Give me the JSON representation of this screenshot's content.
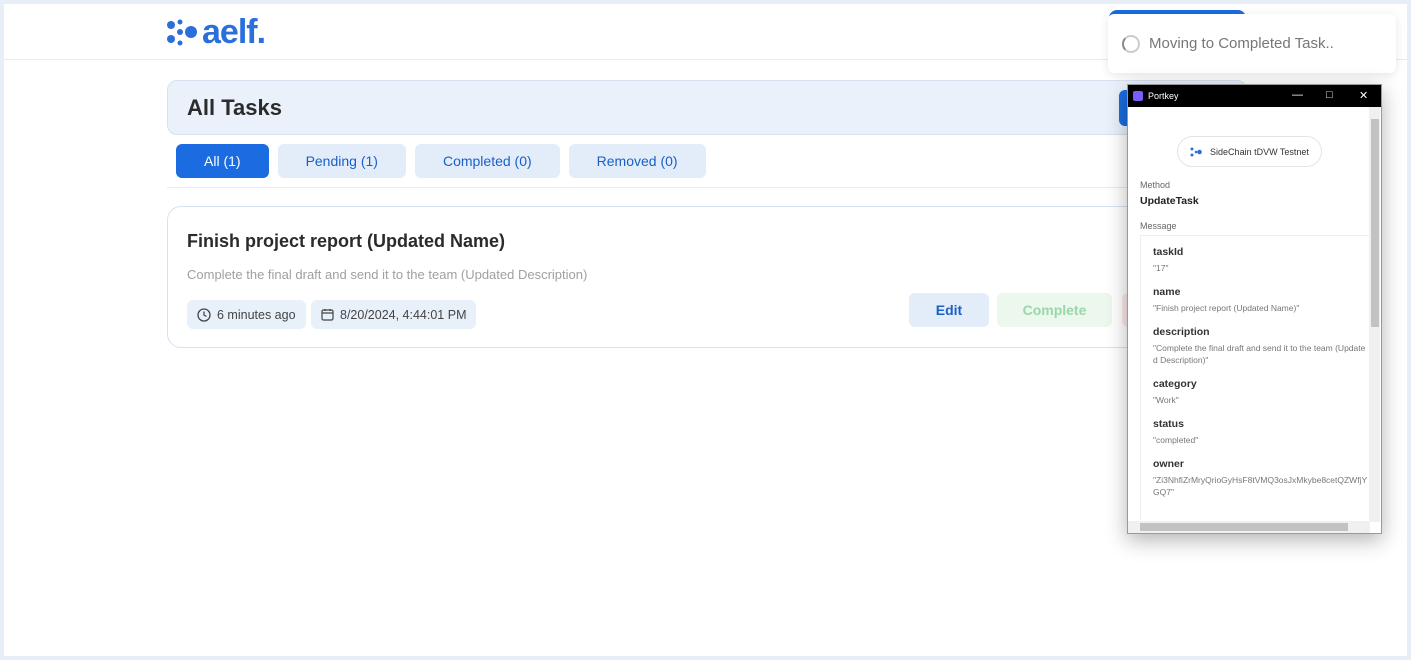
{
  "header": {
    "logo_text": "aelf."
  },
  "page": {
    "title": "All Tasks"
  },
  "tabs": [
    {
      "label": "All (1)"
    },
    {
      "label": "Pending (1)"
    },
    {
      "label": "Completed (0)"
    },
    {
      "label": "Removed (0)"
    }
  ],
  "task": {
    "name": "Finish project report (Updated Name)",
    "description": "Complete the final draft and send it to the team (Updated Description)",
    "relative_time": "6 minutes ago",
    "date": "8/20/2024, 4:44:01 PM",
    "edit_label": "Edit",
    "complete_label": "Complete"
  },
  "toast": {
    "message": "Moving to Completed Task.."
  },
  "popup": {
    "title": "Portkey",
    "network": "SideChain tDVW Testnet",
    "method_label": "Method",
    "method": "UpdateTask",
    "message_label": "Message",
    "fields": [
      {
        "key": "taskId",
        "value": "\"17\""
      },
      {
        "key": "name",
        "value": "\"Finish project report (Updated Name)\""
      },
      {
        "key": "description",
        "value": "\"Complete the final draft and send it to the team (Updated Description)\""
      },
      {
        "key": "category",
        "value": "\"Work\""
      },
      {
        "key": "status",
        "value": "\"completed\""
      },
      {
        "key": "owner",
        "value": "\"Zi3NhfiZrMryQrioGyHsF8tVMQ3osJxMkybe8cetQZWfjYGQ7\""
      }
    ]
  },
  "colors": {
    "primary": "#1a6ce0",
    "complete": "#9ad7a8"
  }
}
